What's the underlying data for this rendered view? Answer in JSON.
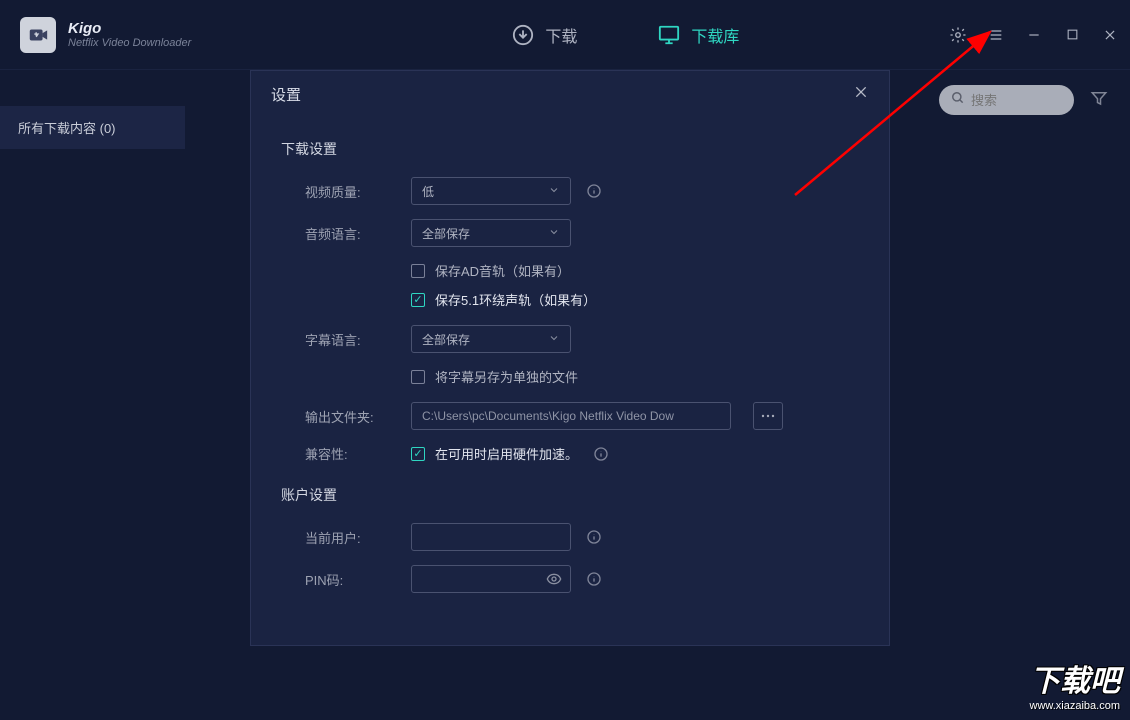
{
  "app": {
    "title": "Kigo",
    "subtitle": "Netflix Video Downloader"
  },
  "tabs": {
    "download": "下载",
    "library": "下载库"
  },
  "sidebar": {
    "all_downloads": "所有下载内容 (0)"
  },
  "search": {
    "placeholder": "搜索"
  },
  "modal": {
    "title": "设置",
    "download_section": "下载设置",
    "video_quality_label": "视频质量:",
    "video_quality_value": "低",
    "audio_language_label": "音频语言:",
    "audio_language_value": "全部保存",
    "save_ad_track": "保存AD音轨（如果有）",
    "save_51_track": "保存5.1环绕声轨（如果有）",
    "subtitle_language_label": "字幕语言:",
    "subtitle_language_value": "全部保存",
    "save_subtitle_separate": "将字幕另存为单独的文件",
    "output_folder_label": "输出文件夹:",
    "output_folder_value": "C:\\Users\\pc\\Documents\\Kigo Netflix Video Dow",
    "compatibility_label": "兼容性:",
    "hardware_accel": "在可用时启用硬件加速。",
    "account_section": "账户设置",
    "current_user_label": "当前用户:",
    "pin_label": "PIN码:"
  },
  "watermark": {
    "big": "下载吧",
    "url": "www.xiazaiba.com"
  }
}
